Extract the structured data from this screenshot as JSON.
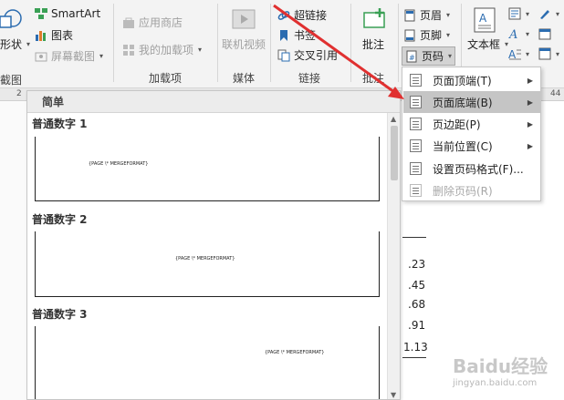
{
  "ribbon": {
    "shape_label": "形状",
    "screenshot_label": "截图",
    "smartart_label": "SmartArt",
    "chart_label": "图表",
    "screen_clip_label": "屏幕截图",
    "app_store_label": "应用商店",
    "my_addins_label": "我的加载项",
    "online_video_label": "联机视频",
    "hyperlink_label": "超链接",
    "bookmark_label": "书签",
    "cross_ref_label": "交叉引用",
    "comment_label": "批注",
    "header_label": "页眉",
    "footer_label": "页脚",
    "page_number_label": "页码",
    "textbox_label": "文本框",
    "groups": {
      "addins": "加载项",
      "media": "媒体",
      "links": "链接",
      "comments": "批注"
    }
  },
  "ruler": {
    "left_mark": "2",
    "right_mark": "44"
  },
  "gallery": {
    "header": "简单",
    "items": [
      {
        "title": "普通数字 1",
        "field": "{PAGE  \\* MERGEFORMAT}"
      },
      {
        "title": "普通数字 2",
        "field": "{PAGE  \\* MERGEFORMAT}"
      },
      {
        "title": "普通数字 3",
        "field": "{PAGE  \\* MERGEFORMAT}"
      }
    ]
  },
  "menu": {
    "items": [
      {
        "label": "页面顶端(T)",
        "has_submenu": true,
        "enabled": true,
        "highlighted": false
      },
      {
        "label": "页面底端(B)",
        "has_submenu": true,
        "enabled": true,
        "highlighted": true
      },
      {
        "label": "页边距(P)",
        "has_submenu": true,
        "enabled": true,
        "highlighted": false
      },
      {
        "label": "当前位置(C)",
        "has_submenu": true,
        "enabled": true,
        "highlighted": false
      },
      {
        "label": "设置页码格式(F)...",
        "has_submenu": false,
        "enabled": true,
        "highlighted": false
      },
      {
        "label": "删除页码(R)",
        "has_submenu": false,
        "enabled": false,
        "highlighted": false
      }
    ]
  },
  "doc_numbers": [
    ".23",
    ".45",
    ".68",
    ".91",
    "1.13"
  ],
  "watermark": {
    "brand": "Baidu经验",
    "url": "jingyan.baidu.com"
  },
  "colors": {
    "arrow": "#e03030",
    "highlight": "#c5c5c5",
    "accent_blue": "#2b6cb0"
  }
}
